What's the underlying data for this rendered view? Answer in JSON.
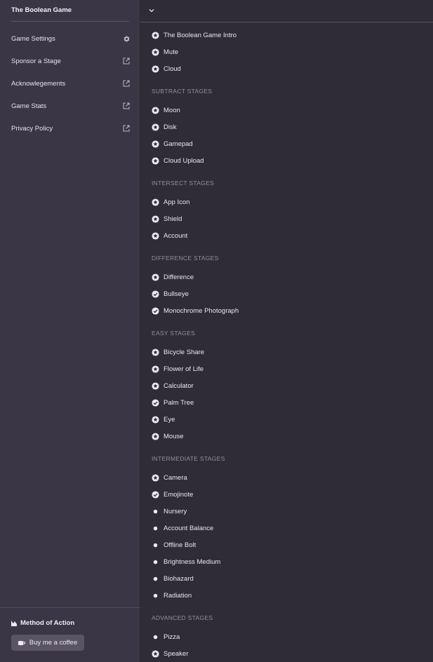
{
  "sidebar": {
    "title": "The Boolean Game",
    "items": [
      {
        "label": "Game Settings",
        "icon": "gear-icon"
      },
      {
        "label": "Sponsor a Stage",
        "icon": "external-link-icon"
      },
      {
        "label": "Acknowlegements",
        "icon": "external-link-icon"
      },
      {
        "label": "Game Stats",
        "icon": "external-link-icon"
      },
      {
        "label": "Privacy Policy",
        "icon": "external-link-icon"
      }
    ],
    "footer": {
      "title": "Method of Action",
      "button_label": "Buy me a coffee"
    }
  },
  "sections": [
    {
      "title": "",
      "stages": [
        {
          "name": "The Boolean Game Intro",
          "status": "star"
        },
        {
          "name": "Mute",
          "status": "star"
        },
        {
          "name": "Cloud",
          "status": "star"
        }
      ]
    },
    {
      "title": "SUBTRACT STAGES",
      "stages": [
        {
          "name": "Moon",
          "status": "star"
        },
        {
          "name": "Disk",
          "status": "star"
        },
        {
          "name": "Gamepad",
          "status": "star"
        },
        {
          "name": "Cloud Upload",
          "status": "star"
        }
      ]
    },
    {
      "title": "INTERSECT STAGES",
      "stages": [
        {
          "name": "App Icon",
          "status": "star"
        },
        {
          "name": "Shield",
          "status": "star"
        },
        {
          "name": "Account",
          "status": "star"
        }
      ]
    },
    {
      "title": "DIFFERENCE STAGES",
      "stages": [
        {
          "name": "Difference",
          "status": "star"
        },
        {
          "name": "Bullseye",
          "status": "check"
        },
        {
          "name": "Monochrome Photograph",
          "status": "check"
        }
      ]
    },
    {
      "title": "EASY STAGES",
      "stages": [
        {
          "name": "Bicycle Share",
          "status": "star"
        },
        {
          "name": "Flower of Life",
          "status": "star"
        },
        {
          "name": "Calculator",
          "status": "star"
        },
        {
          "name": "Palm Tree",
          "status": "check"
        },
        {
          "name": "Eye",
          "status": "star"
        },
        {
          "name": "Mouse",
          "status": "star"
        }
      ]
    },
    {
      "title": "INTERMEDIATE STAGES",
      "stages": [
        {
          "name": "Camera",
          "status": "star"
        },
        {
          "name": "Emojinote",
          "status": "check"
        },
        {
          "name": "Nursery",
          "status": "dot"
        },
        {
          "name": "Account Balance",
          "status": "dot"
        },
        {
          "name": "Offline Bolt",
          "status": "dot"
        },
        {
          "name": "Brightness Medium",
          "status": "dot"
        },
        {
          "name": "Biohazard",
          "status": "dot"
        },
        {
          "name": "Radiation",
          "status": "dot"
        }
      ]
    },
    {
      "title": "ADVANCED STAGES",
      "stages": [
        {
          "name": "Pizza",
          "status": "dot"
        },
        {
          "name": "Speaker",
          "status": "star"
        }
      ]
    }
  ]
}
